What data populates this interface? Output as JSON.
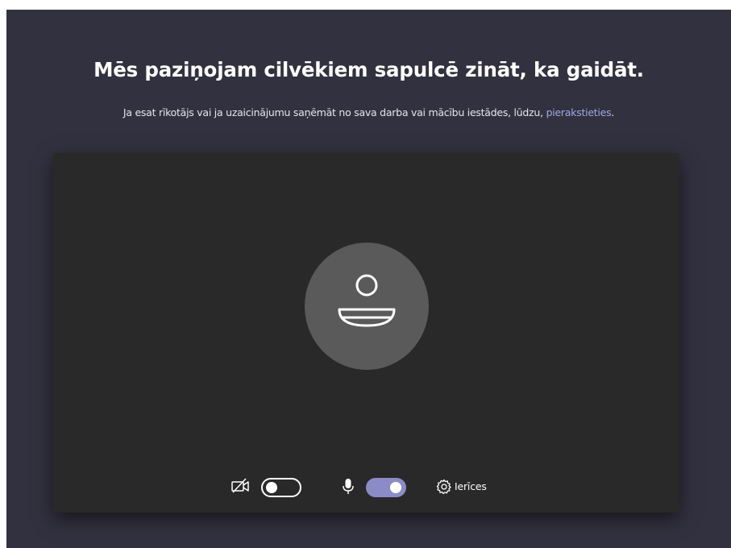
{
  "lobby": {
    "title": "Mēs paziņojam cilvēkiem sapulcē zināt, ka gaidāt.",
    "subtitle_text": "Ja esat rīkotājs vai ja uzaicinājumu saņēmāt no sava darba vai mācību iestādes, lūdzu, ",
    "signin_link": "pierakstieties",
    "subtitle_end": "."
  },
  "controls": {
    "camera": {
      "icon": "camera-off-icon",
      "enabled": false
    },
    "microphone": {
      "icon": "microphone-icon",
      "enabled": true
    },
    "devices": {
      "icon": "gear-icon",
      "label": "Ierīces"
    }
  },
  "preview": {
    "avatar_icon": "person-icon"
  },
  "colors": {
    "background": "#32313f",
    "preview_background": "#292929",
    "avatar_circle": "#5b5a5a",
    "accent": "#8b8cc7",
    "link": "#a5a6e6"
  }
}
